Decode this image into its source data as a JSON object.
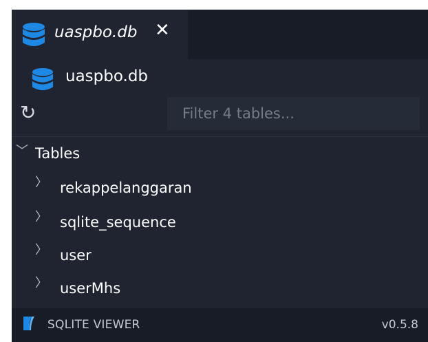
{
  "tab": {
    "title": "uaspbo.db",
    "close_glyph": "✕"
  },
  "file": {
    "name": "uaspbo.db"
  },
  "toolbar": {
    "refresh_glyph": "↻"
  },
  "filter": {
    "placeholder": "Filter 4 tables..."
  },
  "tree": {
    "group_label": "Tables",
    "tables": [
      "rekappelanggaran",
      "sqlite_sequence",
      "user",
      "userMhs"
    ]
  },
  "status": {
    "label": "SQLITE VIEWER",
    "version": "v0.5.8"
  },
  "colors": {
    "db_icon": "#1e88e5",
    "background": "#1f2430",
    "tabbar": "#181c26"
  }
}
